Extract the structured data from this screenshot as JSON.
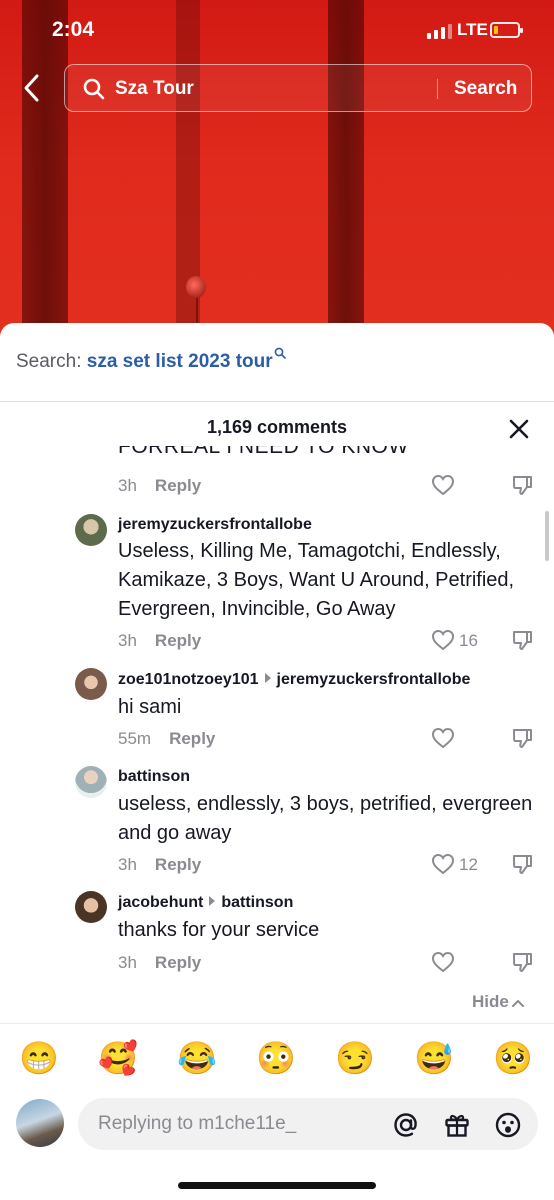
{
  "status_bar": {
    "time": "2:04",
    "network": "LTE",
    "battery_level": 0.18
  },
  "search": {
    "query": "Sza Tour",
    "button_label": "Search"
  },
  "related_search": {
    "prefix": "Search: ",
    "query": "sza set list 2023 tour"
  },
  "comments_header": {
    "count_label": "1,169 comments"
  },
  "partial_comment": {
    "text": "FORREAL I NEED TO KNOW",
    "time": "3h",
    "reply_label": "Reply"
  },
  "comments": [
    {
      "username": "jeremyzuckersfrontallobe",
      "reply_to": "",
      "text": "Useless, Killing Me, Tamagotchi, Endlessly, Kamikaze, 3 Boys, Want U Around, Petrified, Evergreen, Invincible, Go Away",
      "time": "3h",
      "reply_label": "Reply",
      "likes": "16"
    },
    {
      "username": "zoe101notzoey101",
      "reply_to": "jeremyzuckersfrontallobe",
      "text": "hi sami",
      "time": "55m",
      "reply_label": "Reply",
      "likes": ""
    },
    {
      "username": "battinson",
      "reply_to": "",
      "text": "useless, endlessly, 3 boys, petrified, evergreen and go away",
      "time": "3h",
      "reply_label": "Reply",
      "likes": "12"
    },
    {
      "username": "jacobehunt",
      "reply_to": "battinson",
      "text": "thanks for your service",
      "time": "3h",
      "reply_label": "Reply",
      "likes": ""
    }
  ],
  "hide_label": "Hide",
  "emojis": [
    "😁",
    "🥰",
    "😂",
    "😳",
    "😏",
    "😅",
    "🥺"
  ],
  "reply_input": {
    "placeholder": "Replying to m1che11e_"
  },
  "colors": {
    "accent_link": "#2b5da8",
    "video_red": "#e02a1d",
    "meta_gray": "#8a8b91"
  }
}
